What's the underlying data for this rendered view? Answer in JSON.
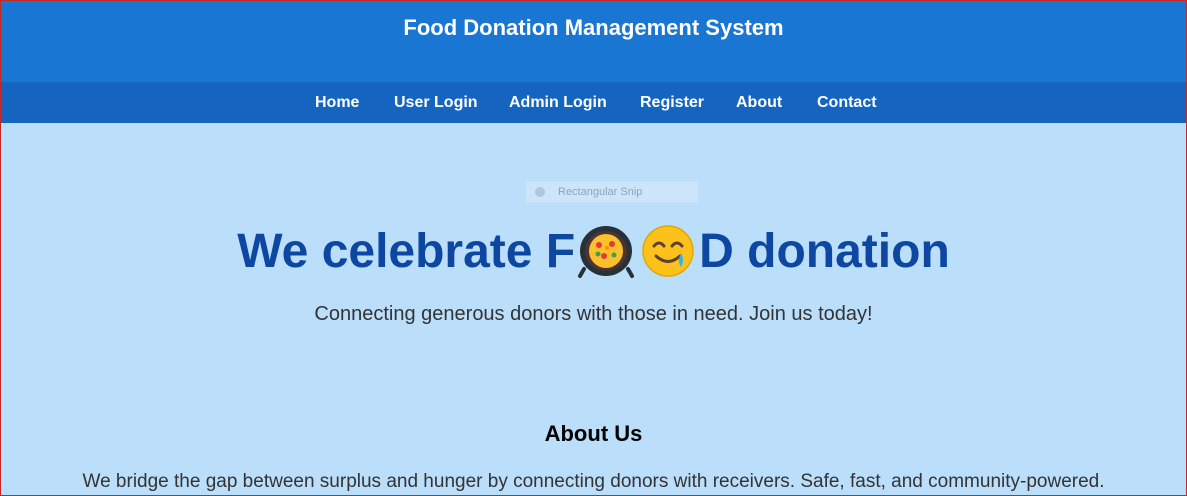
{
  "header": {
    "title": "Food Donation Management System"
  },
  "nav": {
    "items": [
      "Home",
      "User Login",
      "Admin Login",
      "Register",
      "About",
      "Contact"
    ]
  },
  "overlay": {
    "label": "Rectangular Snip"
  },
  "hero": {
    "title_before": "We celebrate F",
    "emoji_1": "pan-of-food-icon",
    "emoji_2": "smiling-face-with-tear-icon",
    "title_after": "D donation",
    "subtitle": "Connecting generous donors with those in need. Join us today!"
  },
  "about": {
    "title": "About Us",
    "text": "We bridge the gap between surplus and hunger by connecting donors with receivers. Safe, fast, and community-powered."
  },
  "colors": {
    "header_bg": "#1976d2",
    "nav_bg": "#1565c0",
    "page_bg": "#bbdefb",
    "hero_text": "#0d47a1"
  }
}
